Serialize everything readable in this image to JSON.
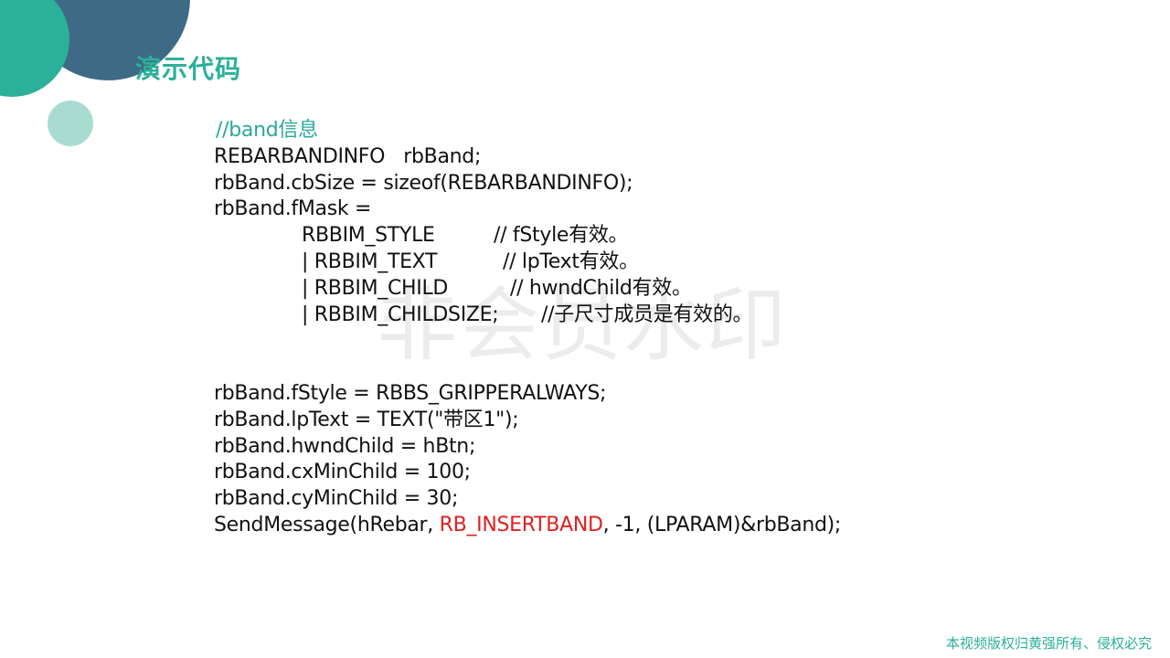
{
  "slide": {
    "title": "演示代码",
    "watermark": "非会员水印",
    "footer": "本视频版权归黄强所有、侵权必究"
  },
  "code": {
    "comment": "//band信息",
    "l1": "REBARBANDINFO   rbBand;",
    "l2": "rbBand.cbSize = sizeof(REBARBANDINFO);",
    "l3": "rbBand.fMask =",
    "m1_code": "RBBIM_STYLE",
    "m1_comment": "// fStyle有效。",
    "m2_code": "| RBBIM_TEXT",
    "m2_comment": "// lpText有效。",
    "m3_code": "| RBBIM_CHILD",
    "m3_comment": "// hwndChild有效。",
    "m4_code": "| RBBIM_CHILDSIZE;",
    "m4_comment": "//子尺寸成员是有效的。",
    "l4": "rbBand.fStyle = RBBS_GRIPPERALWAYS;",
    "l5": "rbBand.lpText = TEXT(\"带区1\");",
    "l6": "rbBand.hwndChild = hBtn;",
    "l7": "rbBand.cxMinChild = 100;",
    "l8": "rbBand.cyMinChild = 30;",
    "send_prefix": "SendMessage(hRebar, ",
    "send_highlight": "RB_INSERTBAND",
    "send_suffix": ", -1, (LPARAM)&rbBand);"
  },
  "colors": {
    "accent": "#2bb09a",
    "dark_circle": "#3f6a86",
    "light_circle": "#a8dcd1",
    "highlight": "#e02020"
  }
}
